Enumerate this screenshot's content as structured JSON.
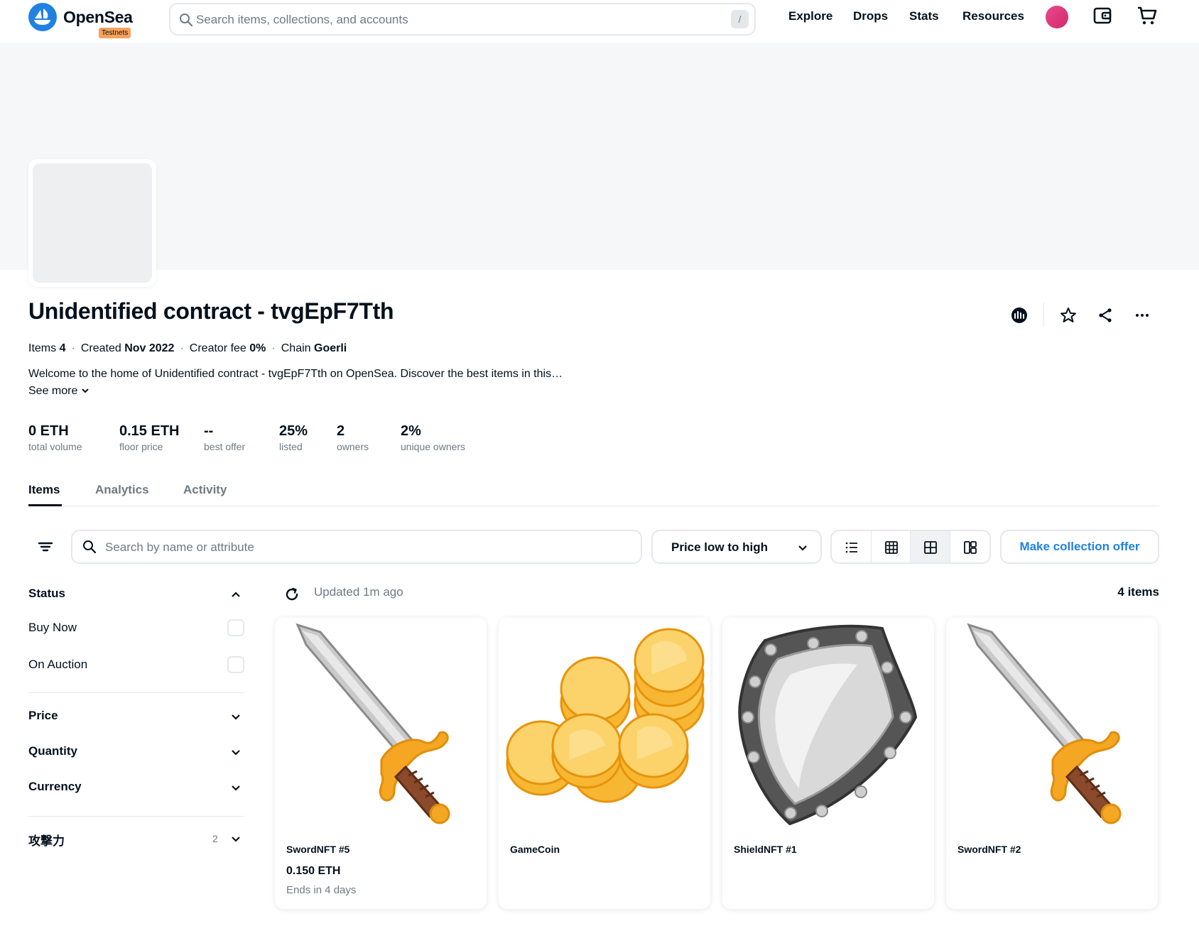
{
  "nav": {
    "logo_text": "OpenSea",
    "testnet_badge": "Testnets",
    "search_placeholder": "Search items, collections, and accounts",
    "search_shortcut": "/",
    "links": [
      "Explore",
      "Drops",
      "Stats",
      "Resources"
    ],
    "avatar_color": "#e94b8a"
  },
  "collection": {
    "title": "Unidentified contract - tvgEpF7Tth",
    "meta": {
      "items_label": "Items",
      "items_value": "4",
      "created_label": "Created",
      "created_value": "Nov 2022",
      "fee_label": "Creator fee",
      "fee_value": "0%",
      "chain_label": "Chain",
      "chain_value": "Goerli",
      "separator": "·"
    },
    "description": "Welcome to the home of Unidentified contract - tvgEpF7Tth on OpenSea. Discover the best items in this…",
    "see_more": "See more",
    "stats": [
      {
        "value": "0 ETH",
        "label": "total volume"
      },
      {
        "value": "0.15 ETH",
        "label": "floor price"
      },
      {
        "value": "--",
        "label": "best offer"
      },
      {
        "value": "25%",
        "label": "listed"
      },
      {
        "value": "2",
        "label": "owners"
      },
      {
        "value": "2%",
        "label": "unique owners"
      }
    ]
  },
  "tabs": [
    "Items",
    "Analytics",
    "Activity"
  ],
  "toolbar": {
    "search_placeholder": "Search by name or attribute",
    "sort_label": "Price low to high",
    "offer_button": "Make collection offer"
  },
  "filters": {
    "status": {
      "label": "Status",
      "options": [
        "Buy Now",
        "On Auction"
      ]
    },
    "price": "Price",
    "quantity": "Quantity",
    "currency": "Currency",
    "attribute": {
      "label": "攻撃力",
      "count": "2"
    }
  },
  "grid": {
    "updated": "Updated 1m ago",
    "count": "4 items",
    "items": [
      {
        "name": "SwordNFT #5",
        "price": "0.150 ETH",
        "ends": "Ends in 4 days",
        "art": "sword"
      },
      {
        "name": "GameCoin",
        "price": "",
        "ends": "",
        "art": "coins"
      },
      {
        "name": "ShieldNFT #1",
        "price": "",
        "ends": "",
        "art": "shield"
      },
      {
        "name": "SwordNFT #2",
        "price": "",
        "ends": "",
        "art": "sword"
      }
    ]
  },
  "colors": {
    "accent": "#2081e2",
    "text": "#04111d",
    "muted": "#707a83",
    "badge": "#f5a25d"
  }
}
